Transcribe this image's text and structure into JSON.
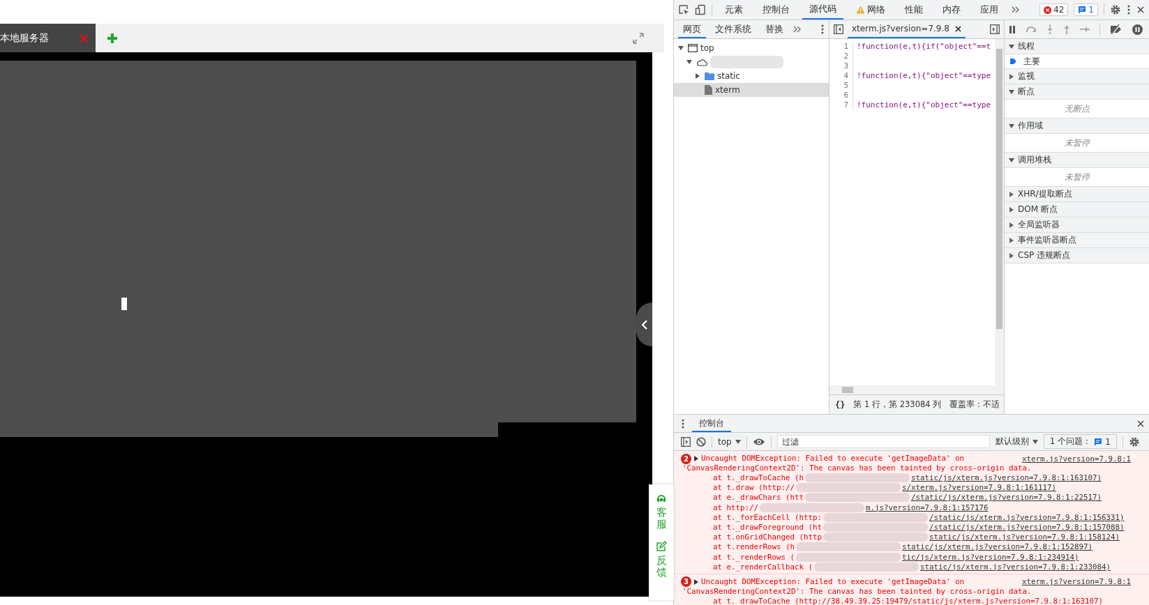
{
  "page": {
    "tab": {
      "title": "本地服务器",
      "closable": true
    },
    "side_widget": [
      {
        "kind": "service",
        "label": "客服"
      },
      {
        "kind": "feedback",
        "label": "反馈"
      }
    ]
  },
  "devtools": {
    "main_tabs": [
      {
        "label": "元素",
        "selected": false
      },
      {
        "label": "控制台",
        "selected": false
      },
      {
        "label": "源代码",
        "selected": true
      },
      {
        "label": "网络",
        "selected": false,
        "warning": true
      },
      {
        "label": "性能",
        "selected": false
      },
      {
        "label": "内存",
        "selected": false
      },
      {
        "label": "应用",
        "selected": false
      }
    ],
    "error_count": "42",
    "issue_count": "1",
    "nav_tabs": [
      {
        "label": "网页",
        "selected": true
      },
      {
        "label": "文件系统",
        "selected": false
      },
      {
        "label": "替换",
        "selected": false
      }
    ],
    "tree": [
      {
        "kind": "frame",
        "label": "top",
        "expanded": true,
        "selected": false,
        "children": [
          {
            "kind": "origin",
            "expanded": true,
            "selected": false,
            "children": [
              {
                "kind": "folder",
                "label": "static",
                "expanded": false,
                "selected": false
              },
              {
                "kind": "file",
                "label": "xterm",
                "selected": true
              }
            ]
          }
        ]
      }
    ],
    "editor_tab": "xterm.js?version=7.9.8",
    "code_lines": [
      {
        "number": "1",
        "code": "!function(e,t){if(\"object\"==t"
      },
      {
        "number": "2"
      },
      {
        "number": "3"
      },
      {
        "number": "4",
        "code": "!function(e,t){\"object\"==type"
      },
      {
        "number": "5"
      },
      {
        "number": "6"
      },
      {
        "number": "7",
        "code": "!function(e,t){\"object\"==type"
      }
    ],
    "pretty_print": "{}",
    "status": "第 1 行，第 233084 列",
    "coverage": "覆盖率：不适",
    "sections": [
      {
        "title": "线程",
        "expanded": true,
        "items": [
          {
            "kind": "thread",
            "label": "主要"
          }
        ]
      },
      {
        "title": "监视",
        "expanded": false
      },
      {
        "title": "断点",
        "expanded": true,
        "items": [
          {
            "kind": "empty",
            "label": "无断点"
          }
        ]
      },
      {
        "title": "作用域",
        "expanded": true,
        "items": [
          {
            "kind": "empty",
            "label": "未暂停"
          }
        ]
      },
      {
        "title": "调用堆栈",
        "expanded": true,
        "items": [
          {
            "kind": "empty",
            "label": "未暂停"
          }
        ]
      },
      {
        "title": "XHR/提取断点",
        "expanded": false
      },
      {
        "title": "DOM 断点",
        "expanded": false
      },
      {
        "title": "全局监听器",
        "expanded": false
      },
      {
        "title": "事件监听器断点",
        "expanded": false
      },
      {
        "title": "CSP 违规断点",
        "expanded": false
      }
    ],
    "console": {
      "tab": "控制台",
      "context": "top",
      "filter_placeholder": "过滤",
      "level": "默认级别",
      "issues": "1 个问题：",
      "issues_count": "1",
      "messages": [
        {
          "count": "2",
          "line1": "Uncaught DOMException: Failed to execute 'getImageData' on",
          "line2": "'CanvasRenderingContext2D': The canvas has been tainted by cross-origin data.",
          "source": "xterm.js?version=7.9.8:1",
          "stack": [
            {
              "prefix": "at t._drawToCache (h",
              "suffix": "static/js/xterm.js?version=7.9.8:1:163107)"
            },
            {
              "prefix": "at t.draw (http://",
              "suffix": "s/xterm.js?version=7.9.8:1:161117)"
            },
            {
              "prefix": "at e._drawChars (htt",
              "suffix": "/static/js/xterm.js?version=7.9.8:1:22517)"
            },
            {
              "prefix": "at http://",
              "suffix": "m.js?version=7.9.8:1:157176"
            },
            {
              "prefix": "at t._forEachCell (http:",
              "suffix": "/static/js/xterm.js?version=7.9.8:1:156331)"
            },
            {
              "prefix": "at t._drawForeground (ht",
              "suffix": "/static/js/xterm.js?version=7.9.8:1:157088)"
            },
            {
              "prefix": "at t.onGridChanged (http",
              "suffix": "static/js/xterm.js?version=7.9.8:1:158124)"
            },
            {
              "prefix": "at t.renderRows (h",
              "suffix": "static/js/xterm.js?version=7.9.8:1:152897)"
            },
            {
              "prefix": "at t._renderRows (",
              "suffix": "tic/js/xterm.js?version=7.9.8:1:234914)"
            },
            {
              "prefix": "at e._renderCallback (",
              "suffix": "static/js/xterm.js?version=7.9.8:1:233084)"
            }
          ]
        },
        {
          "count": "3",
          "line1": "Uncaught DOMException: Failed to execute 'getImageData' on",
          "line2": "'CanvasRenderingContext2D': The canvas has been tainted by cross-origin data.",
          "source": "xterm.js?version=7.9.8:1",
          "stack": [
            {
              "prefix": "at t._drawToCache (http://38.49.39.25:19479/static/js/xterm.js?version=7.9.8:1:163107)"
            }
          ]
        }
      ]
    }
  }
}
